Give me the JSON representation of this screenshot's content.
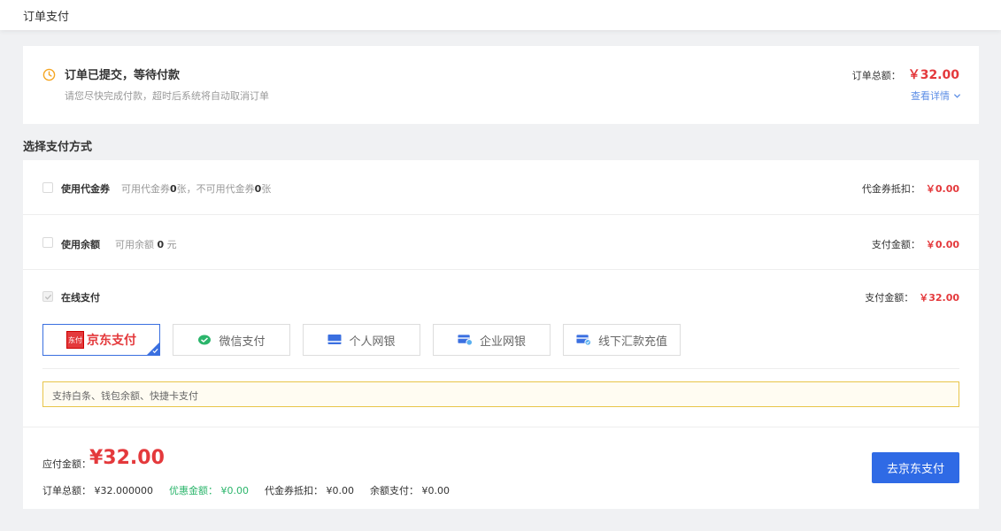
{
  "header": {
    "title": "订单支付"
  },
  "status": {
    "title": "订单已提交，等待付款",
    "subtitle": "请您尽快完成付款，超时后系统将自动取消订单",
    "total_label": "订单总额：",
    "total_amount": "￥32.00",
    "detail_link": "查看详情"
  },
  "section_title": "选择支付方式",
  "voucher": {
    "label": "使用代金券",
    "desc_prefix": "可用代金券",
    "available": "0",
    "desc_mid": "张，不可用代金券",
    "unavailable": "0",
    "desc_suffix": "张",
    "right_label": "代金券抵扣：",
    "right_amount": "￥0.00",
    "checked": false
  },
  "balance": {
    "label": "使用余额",
    "desc_prefix": "可用余额",
    "amount": "0",
    "desc_suffix": "元",
    "right_label": "支付金额：",
    "right_amount": "￥0.00",
    "checked": false
  },
  "online": {
    "label": "在线支付",
    "right_label": "支付金额：",
    "right_amount": "￥32.00",
    "checked": true
  },
  "methods": [
    {
      "label": "京东支付",
      "badge": "东付",
      "selected": true,
      "icon": "jd-pay-icon"
    },
    {
      "label": "微信支付",
      "selected": false,
      "icon": "wechat-icon"
    },
    {
      "label": "个人网银",
      "selected": false,
      "icon": "personal-bank-icon"
    },
    {
      "label": "企业网银",
      "selected": false,
      "icon": "enterprise-bank-icon"
    },
    {
      "label": "线下汇款充值",
      "selected": false,
      "icon": "offline-transfer-icon"
    }
  ],
  "tip": "支持白条、钱包余额、快捷卡支付",
  "footer": {
    "pay_label": "应付金额：",
    "pay_amount": "¥32.00",
    "summary": {
      "order_total_label": "订单总额：",
      "order_total": "¥32.000000",
      "discount_label": "优惠金额：",
      "discount": "¥0.00",
      "voucher_label": "代金券抵扣：",
      "voucher": "¥0.00",
      "balance_label": "余额支付：",
      "balance": "¥0.00"
    },
    "button": "去京东支付"
  },
  "colors": {
    "accent": "#2f6ae5",
    "price": "#e4393c",
    "green": "#2bb56b",
    "tip_border": "#e8c54a"
  }
}
